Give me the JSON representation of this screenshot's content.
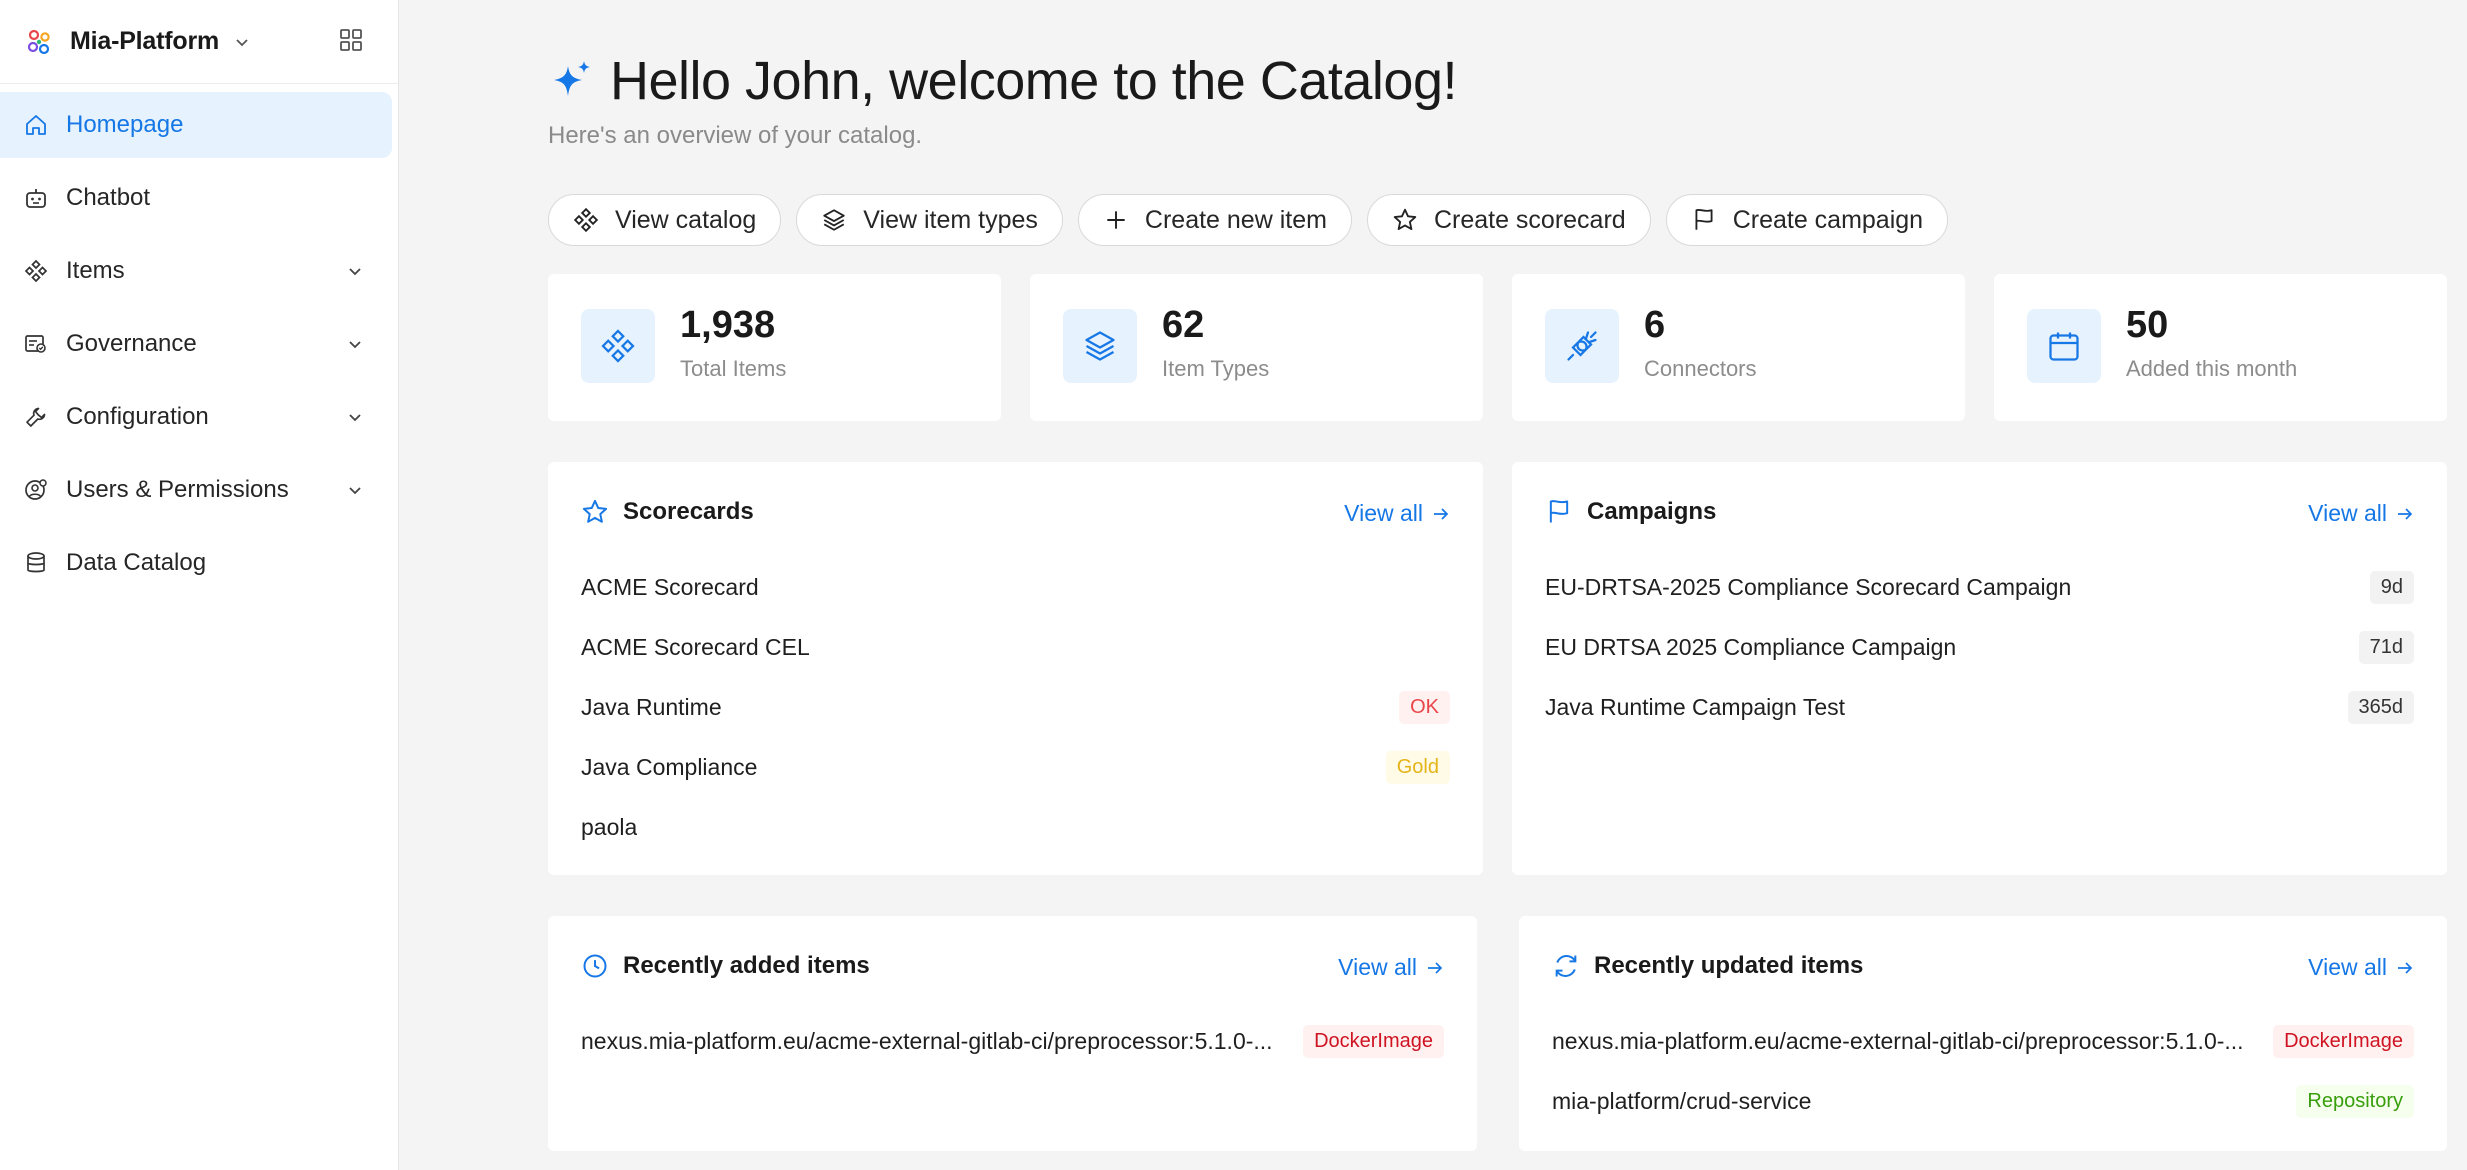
{
  "brand": {
    "name": "Mia-Platform"
  },
  "sidebar": {
    "items": [
      {
        "label": "Homepage"
      },
      {
        "label": "Chatbot"
      },
      {
        "label": "Items"
      },
      {
        "label": "Governance"
      },
      {
        "label": "Configuration"
      },
      {
        "label": "Users & Permissions"
      },
      {
        "label": "Data Catalog"
      }
    ]
  },
  "hero": {
    "title": "Hello John, welcome to the Catalog!",
    "subtitle": "Here's an overview of your catalog."
  },
  "actions": [
    {
      "label": "View catalog"
    },
    {
      "label": "View item types"
    },
    {
      "label": "Create new item"
    },
    {
      "label": "Create scorecard"
    },
    {
      "label": "Create campaign"
    }
  ],
  "stats": [
    {
      "value": "1,938",
      "label": "Total Items"
    },
    {
      "value": "62",
      "label": "Item Types"
    },
    {
      "value": "6",
      "label": "Connectors"
    },
    {
      "value": "50",
      "label": "Added this month"
    }
  ],
  "scorecards": {
    "title": "Scorecards",
    "view_all": "View all",
    "rows": [
      {
        "name": "ACME Scorecard",
        "tag": ""
      },
      {
        "name": "ACME Scorecard CEL",
        "tag": ""
      },
      {
        "name": "Java Runtime",
        "tag": "OK"
      },
      {
        "name": "Java Compliance",
        "tag": "Gold"
      },
      {
        "name": "paola",
        "tag": ""
      }
    ]
  },
  "campaigns": {
    "title": "Campaigns",
    "view_all": "View all",
    "rows": [
      {
        "name": "EU-DRTSA-2025 Compliance Scorecard Campaign",
        "tag": "9d"
      },
      {
        "name": "EU DRTSA 2025 Compliance Campaign",
        "tag": "71d"
      },
      {
        "name": "Java Runtime Campaign Test",
        "tag": "365d"
      }
    ]
  },
  "recently_added": {
    "title": "Recently added items",
    "view_all": "View all",
    "rows": [
      {
        "name": "nexus.mia-platform.eu/acme-external-gitlab-ci/preprocessor:5.1.0-...",
        "tag": "DockerImage"
      }
    ]
  },
  "recently_updated": {
    "title": "Recently updated items",
    "view_all": "View all",
    "rows": [
      {
        "name": "nexus.mia-platform.eu/acme-external-gitlab-ci/preprocessor:5.1.0-...",
        "tag": "DockerImage"
      },
      {
        "name": "mia-platform/crud-service",
        "tag": "Repository"
      }
    ]
  },
  "colors": {
    "accent": "#1677e6",
    "active_bg": "#e6f2fd",
    "page_bg": "#f4f4f4"
  }
}
